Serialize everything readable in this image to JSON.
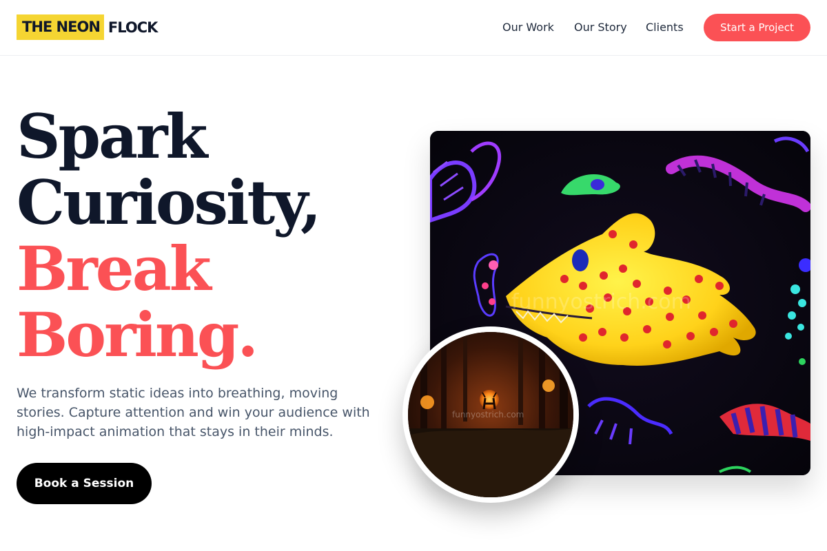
{
  "brand": {
    "highlight": "THE NEON",
    "rest": "FLOCK",
    "highlight_color": "#f5d532"
  },
  "nav": {
    "links": [
      "Our Work",
      "Our Story",
      "Clients"
    ],
    "cta": "Start a Project",
    "cta_color": "#fb5155"
  },
  "hero": {
    "headline": [
      "Spark",
      "Curiosity,",
      "Break",
      "Boring."
    ],
    "headline_dark_color": "#0f172a",
    "headline_accent_color": "#fb5155",
    "lead": "We transform static ideas into breathing, moving stories. Capture attention and win your audience with high-impact animation that stays in their minds.",
    "button": "Book a Session"
  },
  "media": {
    "main_watermark": "funnyostrich.com",
    "circle_watermark": "funnyostrich.com"
  }
}
